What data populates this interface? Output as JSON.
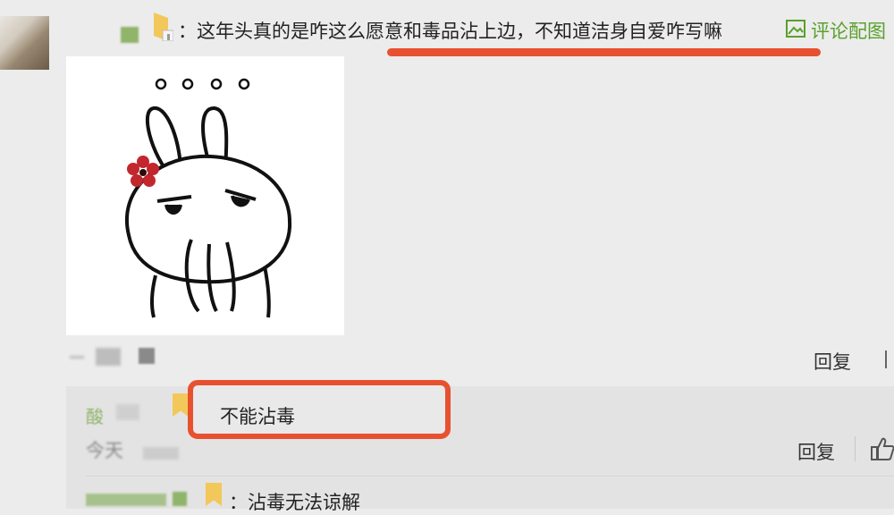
{
  "comment": {
    "text": "：这年头真的是咋这么愿意和毒品沾上边，不知道洁身自爱咋写嘛",
    "image_link_label": "评论配图",
    "image_icon": "image-icon",
    "reply_label": "回复"
  },
  "sticker": {
    "dots": "o o o o",
    "description_icon": "bunny-sticker-icon"
  },
  "replies": [
    {
      "text": "不能沾毒",
      "reply_label": "回复",
      "like_icon": "thumbs-up-icon"
    },
    {
      "text": "：沾毒无法谅解"
    }
  ],
  "colors": {
    "highlight": "#e8512f",
    "link_green": "#5aa02c"
  }
}
